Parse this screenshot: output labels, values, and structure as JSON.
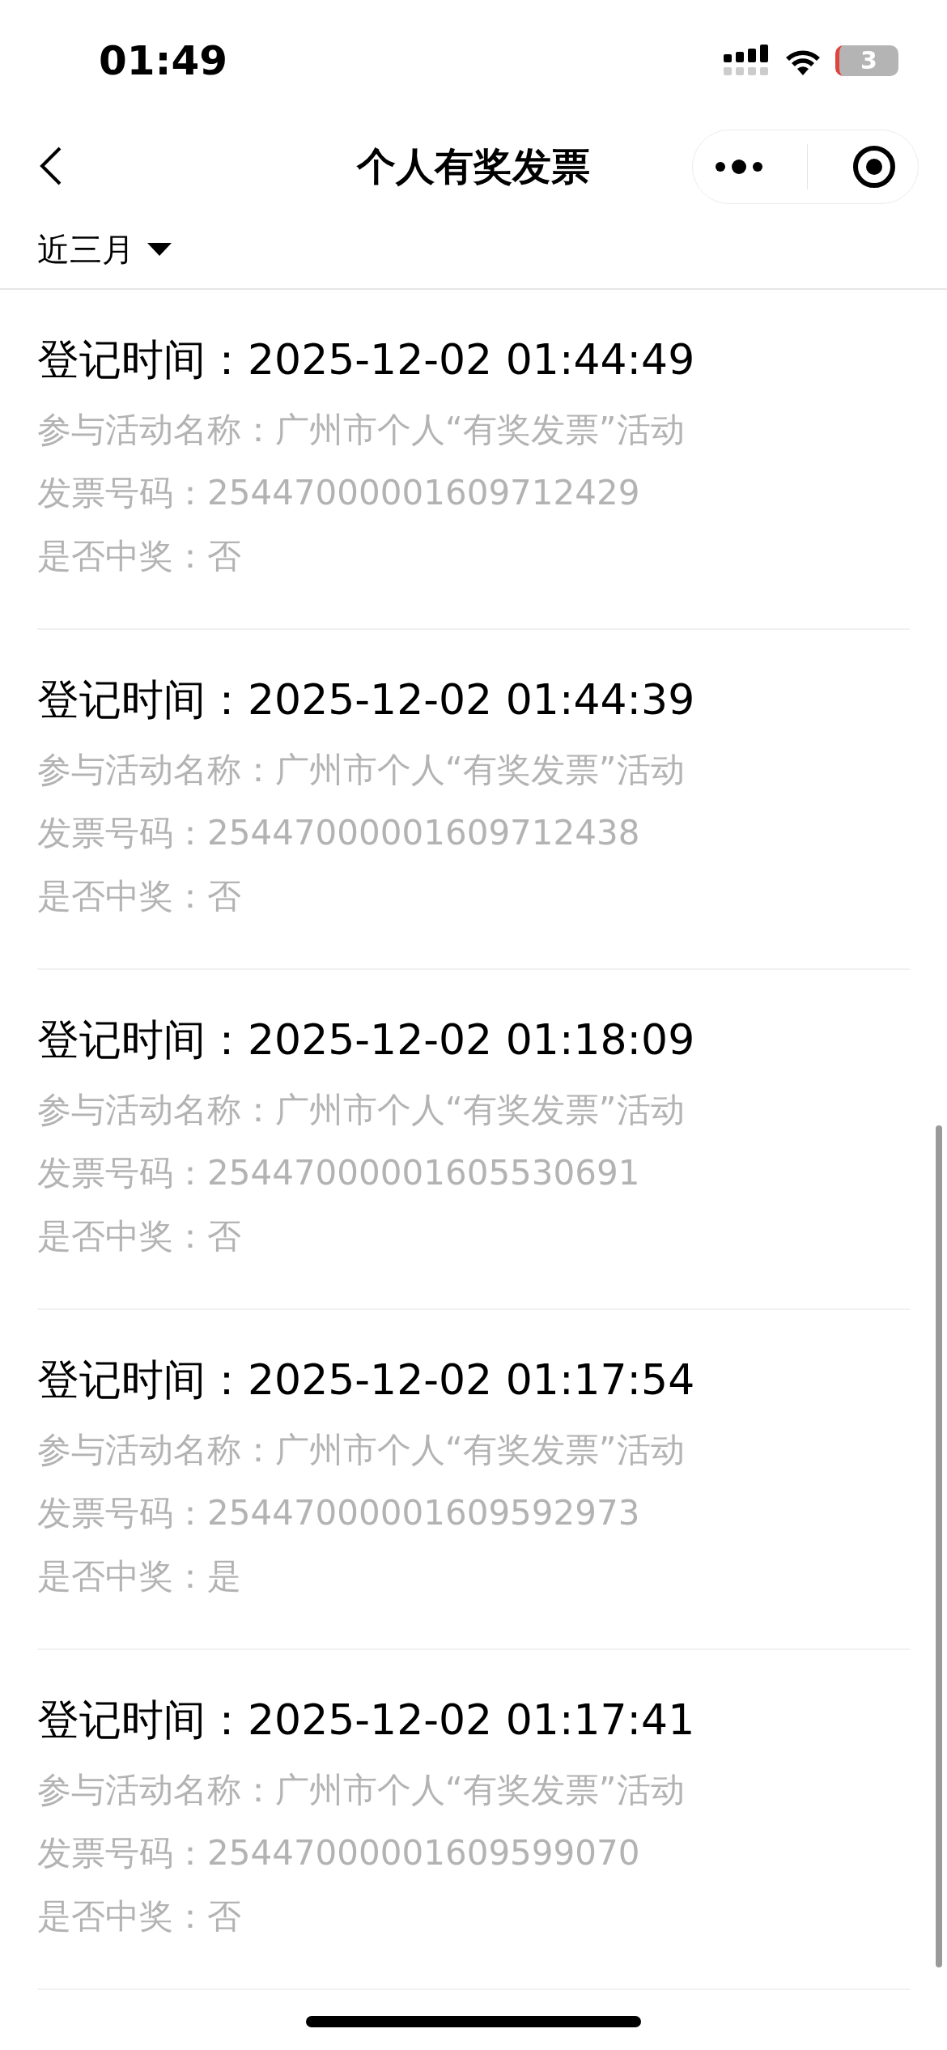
{
  "status_bar": {
    "time": "01:49",
    "battery": "3"
  },
  "nav": {
    "title": "个人有奖发票"
  },
  "filter": {
    "label": "近三月"
  },
  "records": [
    {
      "time_label": "登记时间：",
      "time": "2025-12-02 01:44:49",
      "activity_label": "参与活动名称：",
      "activity": "广州市个人“有奖发票”活动",
      "invoice_label": "发票号码：",
      "invoice": "25447000001609712429",
      "win_label": "是否中奖：",
      "win": "否"
    },
    {
      "time_label": "登记时间：",
      "time": "2025-12-02 01:44:39",
      "activity_label": "参与活动名称：",
      "activity": "广州市个人“有奖发票”活动",
      "invoice_label": "发票号码：",
      "invoice": "25447000001609712438",
      "win_label": "是否中奖：",
      "win": "否"
    },
    {
      "time_label": "登记时间：",
      "time": "2025-12-02 01:18:09",
      "activity_label": "参与活动名称：",
      "activity": "广州市个人“有奖发票”活动",
      "invoice_label": "发票号码：",
      "invoice": "25447000001605530691",
      "win_label": "是否中奖：",
      "win": "否"
    },
    {
      "time_label": "登记时间：",
      "time": "2025-12-02 01:17:54",
      "activity_label": "参与活动名称：",
      "activity": "广州市个人“有奖发票”活动",
      "invoice_label": "发票号码：",
      "invoice": "25447000001609592973",
      "win_label": "是否中奖：",
      "win": "是"
    },
    {
      "time_label": "登记时间：",
      "time": "2025-12-02 01:17:41",
      "activity_label": "参与活动名称：",
      "activity": "广州市个人“有奖发票”活动",
      "invoice_label": "发票号码：",
      "invoice": "25447000001609599070",
      "win_label": "是否中奖：",
      "win": "否"
    }
  ]
}
